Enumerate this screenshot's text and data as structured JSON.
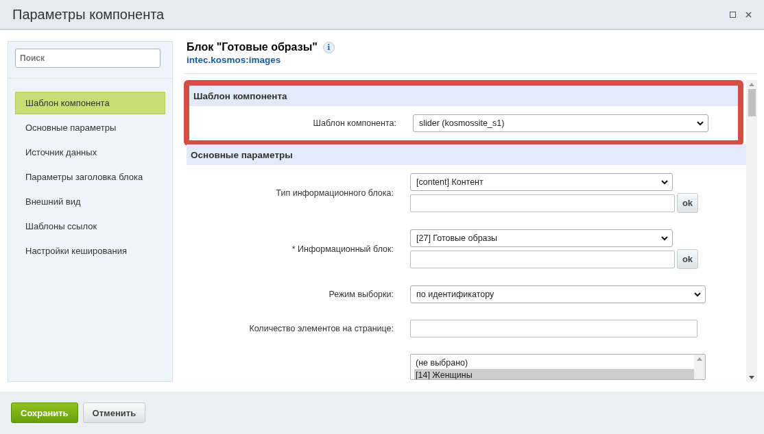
{
  "window": {
    "title": "Параметры компонента"
  },
  "sidebar": {
    "search": {
      "placeholder": "Поиск"
    },
    "items": [
      {
        "label": "Шаблон компонента",
        "selected": true
      },
      {
        "label": "Основные параметры",
        "selected": false
      },
      {
        "label": "Источник данных",
        "selected": false
      },
      {
        "label": "Параметры заголовка блока",
        "selected": false
      },
      {
        "label": "Внешний вид",
        "selected": false
      },
      {
        "label": "Шаблоны ссылок",
        "selected": false
      },
      {
        "label": "Настройки кеширования",
        "selected": false
      }
    ]
  },
  "header": {
    "title": "Блок \"Готовые образы\"",
    "info_icon": "i",
    "component_id": "intec.kosmos:images"
  },
  "sections": [
    {
      "title": "Шаблон компонента",
      "highlighted": true,
      "fields": [
        {
          "kind": "select",
          "label": "Шаблон компонента:",
          "value": "slider (kosmossite_s1)"
        }
      ]
    },
    {
      "title": "Основные параметры",
      "highlighted": false,
      "fields": [
        {
          "kind": "select_ok",
          "label": "Тип информационного блока:",
          "value": "[content] Контент",
          "button": "ok"
        },
        {
          "kind": "select_ok",
          "label": "* Информационный блок:",
          "value": "[27] Готовые образы",
          "button": "ok"
        },
        {
          "kind": "select",
          "label": "Режим выборки:",
          "value": "по идентификатору"
        },
        {
          "kind": "text",
          "label": "Количество элементов на странице:"
        },
        {
          "kind": "list",
          "options": [
            {
              "label": "(не выбрано)",
              "selected": false
            },
            {
              "label": "[14] Женщины",
              "selected": true
            }
          ]
        }
      ]
    }
  ],
  "buttons": [
    {
      "label": "Сохранить",
      "kind": "primary"
    },
    {
      "label": "Отменить",
      "kind": "secondary"
    }
  ]
}
